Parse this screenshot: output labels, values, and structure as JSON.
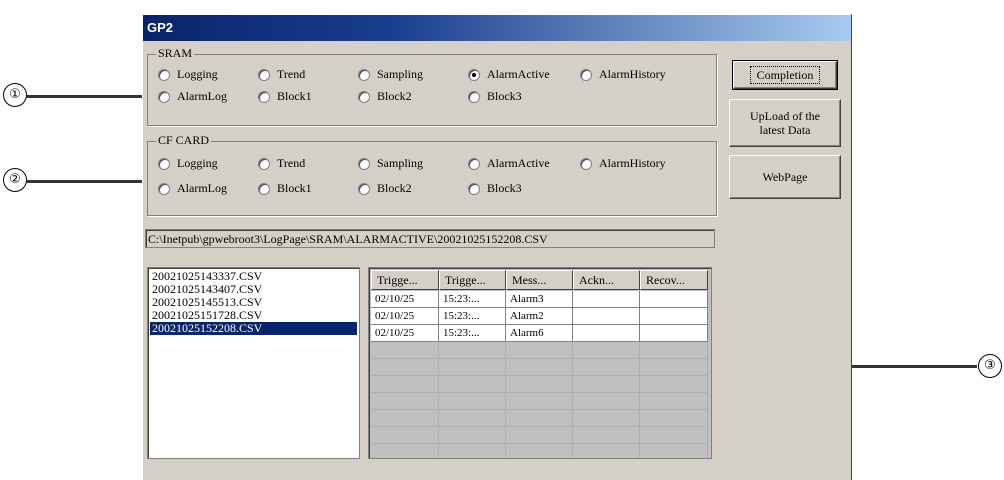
{
  "callouts": [
    "①",
    "②",
    "③"
  ],
  "window": {
    "title": "GP2"
  },
  "sram": {
    "label": "SRAM",
    "options": [
      "Logging",
      "Trend",
      "Sampling",
      "AlarmActive",
      "AlarmHistory",
      "AlarmLog",
      "Block1",
      "Block2",
      "Block3"
    ],
    "selected": "AlarmActive"
  },
  "cf_card": {
    "label": "CF CARD",
    "options": [
      "Logging",
      "Trend",
      "Sampling",
      "AlarmActive",
      "AlarmHistory",
      "AlarmLog",
      "Block1",
      "Block2",
      "Block3"
    ],
    "selected": null
  },
  "buttons": {
    "completion": "Completion",
    "upload_line1": "UpLoad of the",
    "upload_line2": "latest Data",
    "webpage": "WebPage"
  },
  "path": "C:\\Inetpub\\gpwebroot3\\LogPage\\SRAM\\ALARMACTIVE\\20021025152208.CSV",
  "files": {
    "items": [
      "20021025143337.CSV",
      "20021025143407.CSV",
      "20021025145513.CSV",
      "20021025151728.CSV",
      "20021025152208.CSV"
    ],
    "selected_index": 4
  },
  "table": {
    "columns": [
      "Trigge...",
      "Trigge...",
      "Mess...",
      "Ackn...",
      "Recov..."
    ],
    "rows": [
      [
        "02/10/25",
        "15:23:...",
        "Alarm3",
        "",
        ""
      ],
      [
        "02/10/25",
        "15:23:...",
        "Alarm2",
        "",
        ""
      ],
      [
        "02/10/25",
        "15:23:...",
        "Alarm6",
        "",
        ""
      ]
    ]
  }
}
